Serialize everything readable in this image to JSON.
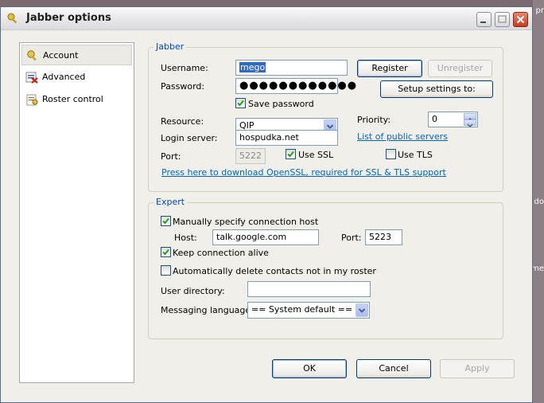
{
  "window": {
    "title": "Jabber options"
  },
  "nav": {
    "items": [
      {
        "label": "Account",
        "icon": "key-icon",
        "selected": true
      },
      {
        "label": "Advanced",
        "icon": "advanced-settings-icon",
        "selected": false
      },
      {
        "label": "Roster control",
        "icon": "roster-icon",
        "selected": false
      }
    ]
  },
  "jabber": {
    "legend": "Jabber",
    "username_label": "Username:",
    "username_value": "mego",
    "password_label": "Password:",
    "password_mask": "●●●●●●●●●●●●",
    "save_password_label": "Save password",
    "save_password_checked": true,
    "resource_label": "Resource:",
    "resource_value": "QIP",
    "login_server_label": "Login server:",
    "login_server_value": "hospudka.net",
    "port_label": "Port:",
    "port_value": "5222",
    "use_ssl_label": "Use SSL",
    "use_ssl_checked": true,
    "use_tls_label": "Use TLS",
    "use_tls_checked": false,
    "priority_label": "Priority:",
    "priority_value": "0",
    "public_servers_link": "List of public servers",
    "openssl_link": "Press here to download OpenSSL, required for SSL & TLS support",
    "register_button": "Register",
    "unregister_button": "Unregister",
    "setup_button": "Setup settings to:"
  },
  "expert": {
    "legend": "Expert",
    "manual_host_label": "Manually specify connection host",
    "manual_host_checked": true,
    "host_label": "Host:",
    "host_value": "talk.google.com",
    "port_label": "Port:",
    "port_value": "5223",
    "keep_alive_label": "Keep connection alive",
    "keep_alive_checked": true,
    "auto_delete_label": "Automatically delete contacts not in my roster",
    "auto_delete_checked": false,
    "user_directory_label": "User directory:",
    "user_directory_value": "",
    "messaging_language_label": "Messaging language:",
    "messaging_language_value": "== System default =="
  },
  "footer": {
    "ok_button": "OK",
    "cancel_button": "Cancel",
    "apply_button": "Apply"
  },
  "desktop": {
    "edge_texts": [
      "pr",
      "do",
      "me"
    ]
  },
  "colors": {
    "legend_blue": "#0046d5",
    "link_blue": "#0066cc",
    "selection_blue": "#316ac5"
  }
}
